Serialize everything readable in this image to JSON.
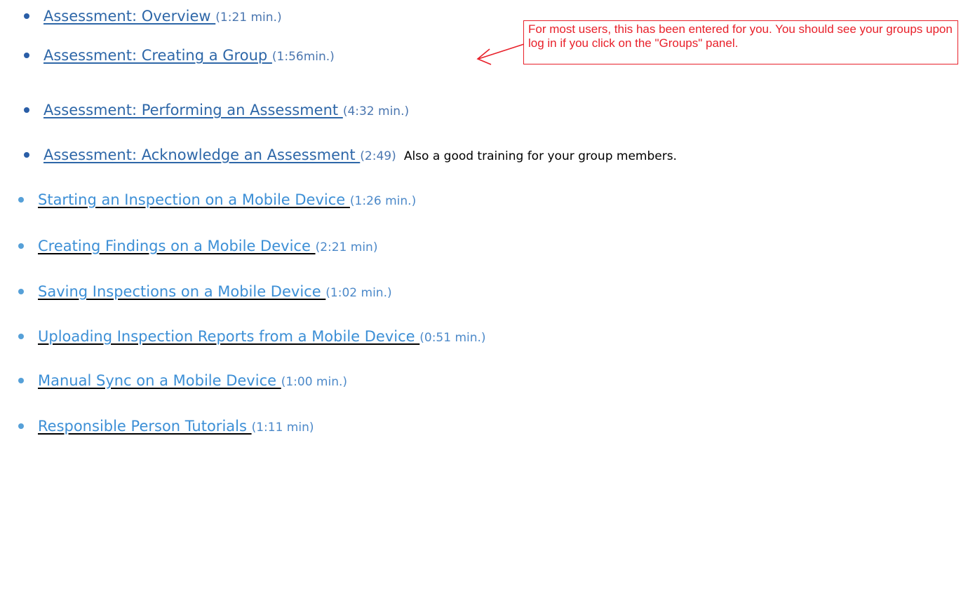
{
  "items": [
    {
      "title": "Assessment: Overview ",
      "duration": "(1:21 min.)",
      "note": ""
    },
    {
      "title": "Assessment: Creating a Group ",
      "duration": "(1:56min.)",
      "note": ""
    },
    {
      "title": "Assessment: Performing an Assessment ",
      "duration": "(4:32 min.)",
      "note": ""
    },
    {
      "title": "Assessment: Acknowledge an Assessment ",
      "duration": "(2:49)",
      "note": "Also a good training for your group members."
    },
    {
      "title": "Starting an Inspection on a Mobile Device ",
      "duration": "(1:26 min.)",
      "note": ""
    },
    {
      "title": "Creating Findings on a Mobile Device ",
      "duration": "(2:21 min)",
      "note": ""
    },
    {
      "title": "Saving Inspections on a Mobile Device ",
      "duration": "(1:02 min.)",
      "note": ""
    },
    {
      "title": "Uploading Inspection Reports from a Mobile Device ",
      "duration": "(0:51 min.)",
      "note": ""
    },
    {
      "title": "Manual Sync on a Mobile Device ",
      "duration": "(1:00 min.)",
      "note": ""
    },
    {
      "title": "Responsible Person Tutorials ",
      "duration": "(1:11 min)",
      "note": ""
    }
  ],
  "callout": {
    "text": "For most users, this has been entered for you. You should see your groups upon log in if you click on the \"Groups\" panel."
  },
  "colors": {
    "link_dark": "#2e67a8",
    "link_light": "#3c8fd6",
    "callout_red": "#e8202a"
  }
}
